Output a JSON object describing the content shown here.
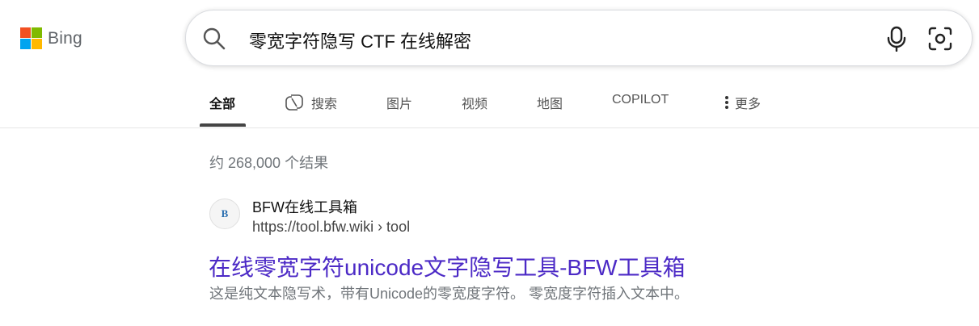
{
  "logo": {
    "text": "Bing",
    "colors": [
      "#f25022",
      "#7fba00",
      "#00a4ef",
      "#ffb900"
    ]
  },
  "search": {
    "query": "零宽字符隐写 CTF 在线解密",
    "icons": [
      "search-icon",
      "microphone-icon",
      "visual-search-icon"
    ]
  },
  "tabs": [
    {
      "label": "全部",
      "active": true
    },
    {
      "label": "搜索",
      "icon": "copilot-icon"
    },
    {
      "label": "图片"
    },
    {
      "label": "视频"
    },
    {
      "label": "地图"
    },
    {
      "label": "COPILOT"
    },
    {
      "label": "更多",
      "icon": "more-vertical-icon"
    }
  ],
  "results": {
    "count_text": "约 268,000 个结果",
    "items": [
      {
        "site_icon_text": "B",
        "site_name": "BFW在线工具箱",
        "url": "https://tool.bfw.wiki › tool",
        "title": "在线零宽字符unicode文字隐写工具-BFW工具箱",
        "snippet": "这是纯文本隐写术，带有Unicode的零宽度字符。 零宽度字符插入文本中。"
      }
    ]
  },
  "colors": {
    "title_link": "#4c2ac6",
    "secondary_text": "#70757a"
  }
}
